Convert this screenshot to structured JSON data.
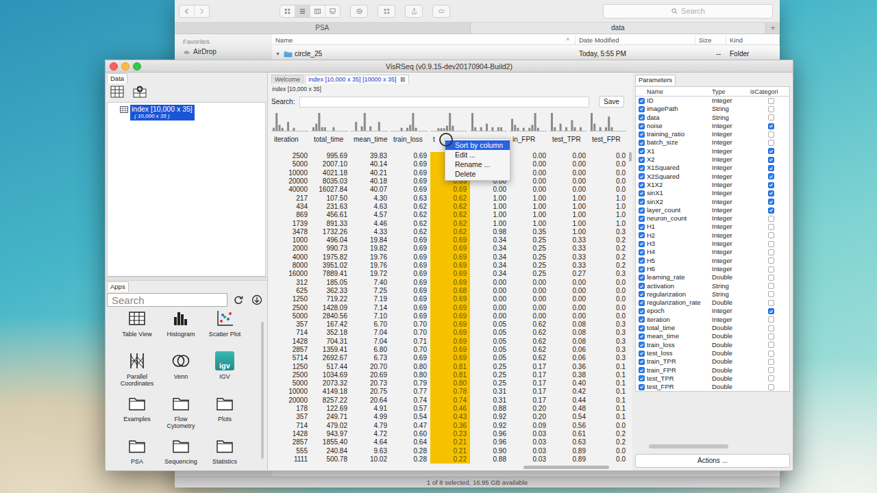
{
  "finder": {
    "search_placeholder": "Search",
    "tabs": [
      {
        "label": "PSA",
        "selected": false
      },
      {
        "label": "data",
        "selected": true
      }
    ],
    "new_tab": "+",
    "sidebar": {
      "heading": "Favorites",
      "items": [
        {
          "label": "AirDrop"
        }
      ]
    },
    "columns": [
      {
        "label": "Name",
        "sorted": true
      },
      {
        "label": "Date Modified",
        "sorted": false
      },
      {
        "label": "Size",
        "sorted": false
      },
      {
        "label": "Kind",
        "sorted": false
      }
    ],
    "sort_glyph": "^",
    "rows": [
      {
        "disclosure": "▼",
        "name": "circle_25",
        "date": "Today, 5:55 PM",
        "size": "--",
        "kind": "Folder"
      }
    ],
    "status": "1 of 8 selected, 16.95 GB available"
  },
  "window": {
    "title": "VisRSeq (v0.9.15-dev20170904-Build2)"
  },
  "data_panel": {
    "tab": "Data",
    "tree": [
      {
        "label": "index [10,000 x 35]",
        "sub": "( 10,000 x 35 )",
        "selected": true
      }
    ]
  },
  "apps_panel": {
    "tab": "Apps",
    "search_placeholder": "Search",
    "apps": [
      {
        "label": "Table View",
        "kind": "table",
        "badge": ""
      },
      {
        "label": "Histogram",
        "kind": "histogram",
        "badge": ""
      },
      {
        "label": "Scatter Plot",
        "kind": "scatter",
        "badge": ""
      },
      {
        "label": "Parallel Coordinates",
        "kind": "parallel",
        "badge": ""
      },
      {
        "label": "Venn",
        "kind": "venn",
        "badge": ""
      },
      {
        "label": "IGV",
        "kind": "igv",
        "badge": "igv"
      },
      {
        "label": "Examples",
        "kind": "folder",
        "badge": ""
      },
      {
        "label": "Flow Cytometry",
        "kind": "folder",
        "badge": ""
      },
      {
        "label": "Plots",
        "kind": "folder",
        "badge": ""
      },
      {
        "label": "PSA",
        "kind": "folder",
        "badge": ""
      },
      {
        "label": "Sequencing",
        "kind": "folder",
        "badge": ""
      },
      {
        "label": "Statistics",
        "kind": "folder",
        "badge": ""
      }
    ]
  },
  "editor": {
    "tabs": [
      {
        "label": "Welcome",
        "selected": false,
        "closable": false
      },
      {
        "label": "index [10,000 x 35] [10000 x 35]",
        "selected": true,
        "closable": true
      }
    ],
    "close_glyph": "⊠",
    "caption": "index [10,000 x 35]",
    "search_label": "Search:",
    "search_value": "",
    "save": "Save",
    "columns": [
      {
        "name": "iteration",
        "highlighted": false,
        "hist": [
          1,
          6,
          2,
          1,
          0,
          3,
          0,
          1,
          0,
          0,
          0,
          0
        ]
      },
      {
        "name": "total_time",
        "highlighted": false,
        "hist": [
          1,
          2,
          5,
          1,
          1,
          0,
          0,
          1,
          0,
          0,
          0,
          0
        ]
      },
      {
        "name": "mean_time",
        "highlighted": false,
        "hist": [
          0,
          2,
          0,
          1,
          4,
          0,
          1,
          0,
          0,
          2,
          0,
          0
        ]
      },
      {
        "name": "train_loss",
        "highlighted": false,
        "hist": [
          0,
          0,
          0,
          1,
          0,
          1,
          2,
          6,
          1,
          0,
          0,
          0
        ]
      },
      {
        "name": "t",
        "highlighted": true,
        "hist": [
          0,
          0,
          1,
          1,
          1,
          2,
          7,
          2,
          0,
          0,
          0,
          0
        ]
      },
      {
        "name": "",
        "highlighted": false,
        "hist": [
          5,
          1,
          0,
          1,
          0,
          2,
          0,
          1,
          0,
          1,
          1,
          0
        ]
      },
      {
        "name": "in_FPR",
        "highlighted": false,
        "hist": [
          4,
          2,
          1,
          0,
          1,
          0,
          1,
          2,
          6,
          1,
          0,
          0
        ]
      },
      {
        "name": "test_TPR",
        "highlighted": false,
        "hist": [
          5,
          1,
          0,
          2,
          0,
          1,
          0,
          3,
          1,
          0,
          1,
          0
        ]
      },
      {
        "name": "test_FPR",
        "highlighted": false,
        "hist": [
          5,
          2,
          0,
          1,
          0,
          1,
          4,
          1,
          0,
          0,
          0,
          0
        ]
      }
    ],
    "rows": [
      [
        "2500",
        "995.69",
        "39.83",
        "0.69",
        "",
        "",
        "0.00",
        "0.00",
        "0.0"
      ],
      [
        "5000",
        "2007.10",
        "40.14",
        "0.69",
        "",
        "",
        "0.00",
        "0.00",
        "0.0"
      ],
      [
        "10000",
        "4021.18",
        "40.21",
        "0.69",
        "",
        "",
        "0.00",
        "0.00",
        "0.0"
      ],
      [
        "20000",
        "8035.03",
        "40.18",
        "0.69",
        "0.69",
        "0.00",
        "0.00",
        "0.00",
        "0.0"
      ],
      [
        "40000",
        "16027.84",
        "40.07",
        "0.69",
        "0.69",
        "0.00",
        "0.00",
        "0.00",
        "0.0"
      ],
      [
        "217",
        "107.50",
        "4.30",
        "0.63",
        "0.62",
        "1.00",
        "1.00",
        "1.00",
        "1.0"
      ],
      [
        "434",
        "231.63",
        "4.63",
        "0.62",
        "0.62",
        "1.00",
        "1.00",
        "1.00",
        "1.0"
      ],
      [
        "869",
        "456.61",
        "4.57",
        "0.62",
        "0.62",
        "1.00",
        "1.00",
        "1.00",
        "1.0"
      ],
      [
        "1739",
        "891.33",
        "4.46",
        "0.62",
        "0.62",
        "1.00",
        "1.00",
        "1.00",
        "1.0"
      ],
      [
        "3478",
        "1732.26",
        "4.33",
        "0.62",
        "0.62",
        "0.98",
        "0.35",
        "1.00",
        "0.3"
      ],
      [
        "1000",
        "496.04",
        "19.84",
        "0.69",
        "0.69",
        "0.34",
        "0.25",
        "0.33",
        "0.2"
      ],
      [
        "2000",
        "990.73",
        "19.82",
        "0.69",
        "0.69",
        "0.34",
        "0.25",
        "0.33",
        "0.2"
      ],
      [
        "4000",
        "1975.82",
        "19.76",
        "0.69",
        "0.69",
        "0.34",
        "0.25",
        "0.33",
        "0.2"
      ],
      [
        "8000",
        "3951.02",
        "19.76",
        "0.69",
        "0.69",
        "0.34",
        "0.25",
        "0.33",
        "0.2"
      ],
      [
        "16000",
        "7889.41",
        "19.72",
        "0.69",
        "0.69",
        "0.34",
        "0.25",
        "0.27",
        "0.3"
      ],
      [
        "312",
        "185.05",
        "7.40",
        "0.69",
        "0.69",
        "0.00",
        "0.00",
        "0.00",
        "0.0"
      ],
      [
        "625",
        "362.33",
        "7.25",
        "0.69",
        "0.68",
        "0.00",
        "0.00",
        "0.00",
        "0.0"
      ],
      [
        "1250",
        "719.22",
        "7.19",
        "0.69",
        "0.69",
        "0.00",
        "0.00",
        "0.00",
        "0.0"
      ],
      [
        "2500",
        "1428.09",
        "7.14",
        "0.69",
        "0.69",
        "0.00",
        "0.00",
        "0.00",
        "0.0"
      ],
      [
        "5000",
        "2840.56",
        "7.10",
        "0.69",
        "0.69",
        "0.00",
        "0.00",
        "0.00",
        "0.0"
      ],
      [
        "357",
        "167.42",
        "6.70",
        "0.70",
        "0.69",
        "0.05",
        "0.62",
        "0.08",
        "0.3"
      ],
      [
        "714",
        "352.18",
        "7.04",
        "0.70",
        "0.69",
        "0.05",
        "0.62",
        "0.08",
        "0.3"
      ],
      [
        "1428",
        "704.31",
        "7.04",
        "0.71",
        "0.69",
        "0.05",
        "0.62",
        "0.08",
        "0.3"
      ],
      [
        "2857",
        "1359.41",
        "6.80",
        "0.70",
        "0.69",
        "0.05",
        "0.62",
        "0.06",
        "0.3"
      ],
      [
        "5714",
        "2692.67",
        "6.73",
        "0.69",
        "0.69",
        "0.05",
        "0.62",
        "0.06",
        "0.3"
      ],
      [
        "1250",
        "517.44",
        "20.70",
        "0.80",
        "0.81",
        "0.25",
        "0.17",
        "0.36",
        "0.1"
      ],
      [
        "2500",
        "1034.69",
        "20.69",
        "0.80",
        "0.81",
        "0.25",
        "0.17",
        "0.38",
        "0.1"
      ],
      [
        "5000",
        "2073.32",
        "20.73",
        "0.79",
        "0.80",
        "0.25",
        "0.17",
        "0.40",
        "0.1"
      ],
      [
        "10000",
        "4149.18",
        "20.75",
        "0.77",
        "0.78",
        "0.31",
        "0.17",
        "0.42",
        "0.1"
      ],
      [
        "20000",
        "8257.22",
        "20.64",
        "0.74",
        "0.74",
        "0.31",
        "0.17",
        "0.44",
        "0.1"
      ],
      [
        "178",
        "122.69",
        "4.91",
        "0.57",
        "0.46",
        "0.88",
        "0.20",
        "0.48",
        "0.1"
      ],
      [
        "357",
        "249.71",
        "4.99",
        "0.54",
        "0.43",
        "0.92",
        "0.20",
        "0.54",
        "0.1"
      ],
      [
        "714",
        "479.02",
        "4.79",
        "0.47",
        "0.36",
        "0.92",
        "0.09",
        "0.56",
        "0.0"
      ],
      [
        "1428",
        "943.97",
        "4.72",
        "0.60",
        "0.23",
        "0.96",
        "0.03",
        "0.61",
        "0.2"
      ],
      [
        "2857",
        "1855.40",
        "4.64",
        "0.64",
        "0.21",
        "0.96",
        "0.03",
        "0.63",
        "0.2"
      ],
      [
        "555",
        "240.84",
        "9.63",
        "0.28",
        "0.21",
        "0.90",
        "0.03",
        "0.89",
        "0.0"
      ],
      [
        "1111",
        "500.78",
        "10.02",
        "0.28",
        "0.22",
        "0.88",
        "0.03",
        "0.89",
        "0.0"
      ]
    ],
    "context_menu": {
      "items": [
        {
          "label": "Sort by column",
          "selected": true
        },
        {
          "label": "Edit ...",
          "selected": false
        },
        {
          "label": "Rename ...",
          "selected": false
        },
        {
          "label": "Delete",
          "selected": false
        }
      ]
    }
  },
  "parameters": {
    "tab": "Parameters",
    "columns": [
      "Name",
      "Type",
      "isCategori"
    ],
    "actions": "Actions ...",
    "rows": [
      {
        "enabled": true,
        "name": "ID",
        "type": "Integer",
        "categorical": false
      },
      {
        "enabled": true,
        "name": "imagePath",
        "type": "String",
        "categorical": false
      },
      {
        "enabled": true,
        "name": "data",
        "type": "String",
        "categorical": false
      },
      {
        "enabled": true,
        "name": "noise",
        "type": "Integer",
        "categorical": true
      },
      {
        "enabled": true,
        "name": "training_ratio",
        "type": "Integer",
        "categorical": false
      },
      {
        "enabled": true,
        "name": "batch_size",
        "type": "Integer",
        "categorical": false
      },
      {
        "enabled": true,
        "name": "X1",
        "type": "Integer",
        "categorical": true
      },
      {
        "enabled": true,
        "name": "X2",
        "type": "Integer",
        "categorical": true
      },
      {
        "enabled": true,
        "name": "X1Squared",
        "type": "Integer",
        "categorical": true
      },
      {
        "enabled": true,
        "name": "X2Squared",
        "type": "Integer",
        "categorical": true
      },
      {
        "enabled": true,
        "name": "X1X2",
        "type": "Integer",
        "categorical": true
      },
      {
        "enabled": true,
        "name": "sinX1",
        "type": "Integer",
        "categorical": true
      },
      {
        "enabled": true,
        "name": "sinX2",
        "type": "Integer",
        "categorical": true
      },
      {
        "enabled": true,
        "name": "layer_count",
        "type": "Integer",
        "categorical": true
      },
      {
        "enabled": true,
        "name": "neuron_count",
        "type": "Integer",
        "categorical": false
      },
      {
        "enabled": true,
        "name": "H1",
        "type": "Integer",
        "categorical": false
      },
      {
        "enabled": true,
        "name": "H2",
        "type": "Integer",
        "categorical": false
      },
      {
        "enabled": true,
        "name": "H3",
        "type": "Integer",
        "categorical": false
      },
      {
        "enabled": true,
        "name": "H4",
        "type": "Integer",
        "categorical": false
      },
      {
        "enabled": true,
        "name": "H5",
        "type": "Integer",
        "categorical": false
      },
      {
        "enabled": true,
        "name": "H6",
        "type": "Integer",
        "categorical": false
      },
      {
        "enabled": true,
        "name": "learning_rate",
        "type": "Double",
        "categorical": false
      },
      {
        "enabled": true,
        "name": "activation",
        "type": "String",
        "categorical": false
      },
      {
        "enabled": true,
        "name": "regularization",
        "type": "String",
        "categorical": false
      },
      {
        "enabled": true,
        "name": "regularization_rate",
        "type": "Double",
        "categorical": false
      },
      {
        "enabled": true,
        "name": "epoch",
        "type": "Integer",
        "categorical": true
      },
      {
        "enabled": true,
        "name": "iteration",
        "type": "Integer",
        "categorical": false
      },
      {
        "enabled": true,
        "name": "total_time",
        "type": "Double",
        "categorical": false
      },
      {
        "enabled": true,
        "name": "mean_time",
        "type": "Double",
        "categorical": false
      },
      {
        "enabled": true,
        "name": "train_loss",
        "type": "Double",
        "categorical": false
      },
      {
        "enabled": true,
        "name": "test_loss",
        "type": "Double",
        "categorical": false
      },
      {
        "enabled": true,
        "name": "train_TPR",
        "type": "Double",
        "categorical": false
      },
      {
        "enabled": true,
        "name": "train_FPR",
        "type": "Double",
        "categorical": false
      },
      {
        "enabled": true,
        "name": "test_TPR",
        "type": "Double",
        "categorical": false
      },
      {
        "enabled": true,
        "name": "test_FPR",
        "type": "Double",
        "categorical": false
      }
    ]
  }
}
